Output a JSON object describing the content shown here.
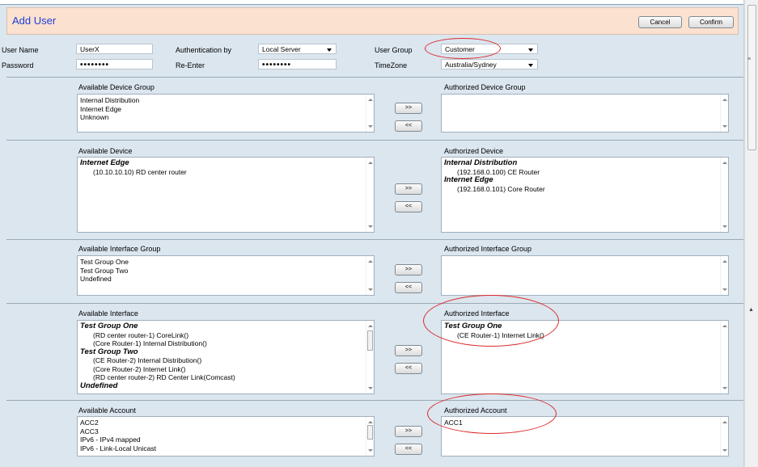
{
  "header": {
    "title": "Add User",
    "cancel_label": "Cancel",
    "confirm_label": "Confirm"
  },
  "form": {
    "username_label": "User Name",
    "username_value": "UserX",
    "password_label": "Password",
    "password_value": "••••••••",
    "auth_label": "Authentication by",
    "auth_value": "Local Server",
    "reenter_label": "Re-Enter",
    "reenter_value": "••••••••",
    "group_label": "User Group",
    "group_value": "Customer",
    "tz_label": "TimeZone",
    "tz_value": "Australia/Sydney"
  },
  "buttons": {
    "add": ">>",
    "remove": "<<"
  },
  "sections": {
    "device_group": {
      "avail_label": "Available Device Group",
      "auth_label": "Authorized Device Group",
      "available": [
        "Internal Distribution",
        "Internet Edge",
        "Unknown"
      ],
      "authorized": []
    },
    "device": {
      "avail_label": "Available Device",
      "auth_label": "Authorized Device",
      "available": [
        {
          "text": "Internet Edge",
          "group": true
        },
        {
          "text": "(10.10.10.10) RD center router",
          "group": false
        }
      ],
      "authorized": [
        {
          "text": "Internal Distribution",
          "group": true
        },
        {
          "text": "(192.168.0.100) CE Router",
          "group": false
        },
        {
          "text": "Internet Edge",
          "group": true
        },
        {
          "text": "(192.168.0.101) Core Router",
          "group": false
        }
      ]
    },
    "interface_group": {
      "avail_label": "Available Interface Group",
      "auth_label": "Authorized Interface Group",
      "available": [
        "Test Group One",
        "Test Group Two",
        "Undefined"
      ],
      "authorized": []
    },
    "interface": {
      "avail_label": "Available Interface",
      "auth_label": "Authorized Interface",
      "available": [
        {
          "text": "Test Group One",
          "group": true
        },
        {
          "text": "(RD center router-1) CoreLink()",
          "group": false
        },
        {
          "text": "(Core Router-1) Internal Distribution()",
          "group": false
        },
        {
          "text": "Test Group Two",
          "group": true
        },
        {
          "text": "(CE Router-2) Internal Distribution()",
          "group": false
        },
        {
          "text": "(Core Router-2) Internet Link()",
          "group": false
        },
        {
          "text": "(RD center router-2) RD Center Link(Comcast)",
          "group": false
        },
        {
          "text": "Undefined",
          "group": true
        }
      ],
      "authorized": [
        {
          "text": "Test Group One",
          "group": true
        },
        {
          "text": "(CE Router-1) Internet Link()",
          "group": false
        }
      ]
    },
    "account": {
      "avail_label": "Available Account",
      "auth_label": "Authorized Account",
      "available": [
        "ACC2",
        "ACC3",
        "IPv6 - IPv4 mapped",
        "IPv6 - Link-Local Unicast"
      ],
      "authorized": [
        "ACC1"
      ]
    }
  },
  "colors": {
    "title": "#1e3fd8",
    "header_bg": "#fbe1cf",
    "panel_bg": "#dbe6ef",
    "highlight": "#dd2a2a"
  }
}
